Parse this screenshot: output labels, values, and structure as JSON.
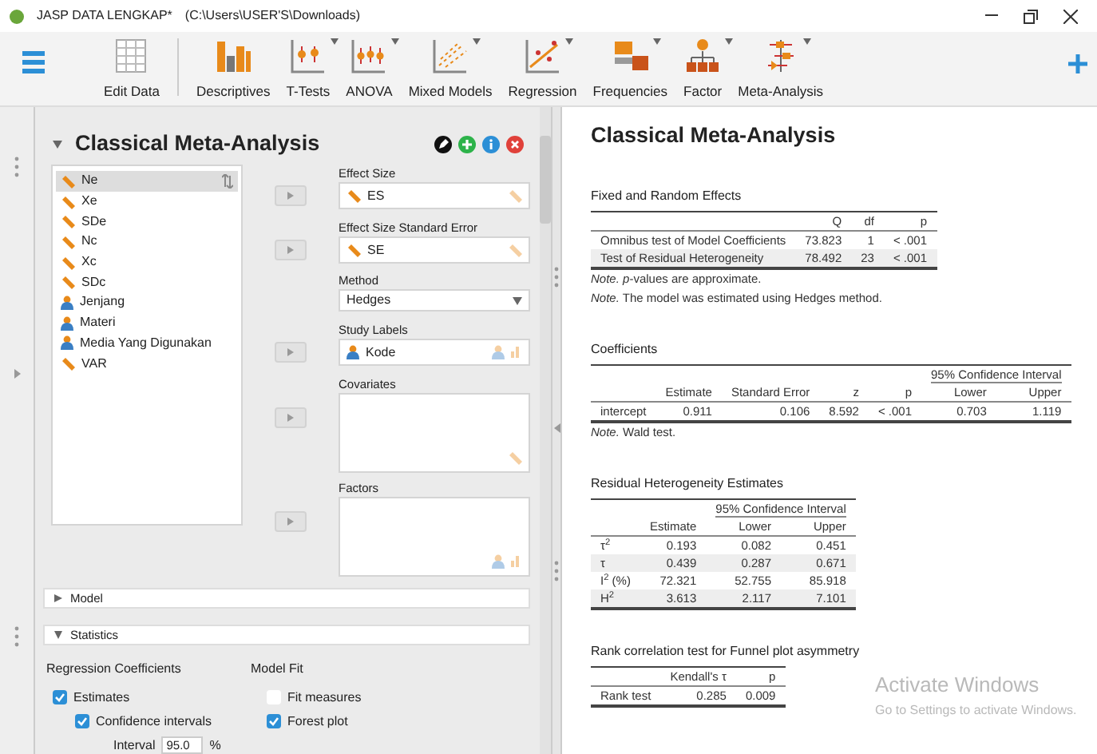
{
  "window": {
    "title": "JASP DATA LENGKAP*",
    "path": "(C:\\Users\\USER'S\\Downloads)"
  },
  "toolbar": [
    {
      "label": "Edit Data",
      "kind": "grid",
      "menu": false
    },
    {
      "label": "Descriptives",
      "kind": "bars",
      "menu": false
    },
    {
      "label": "T-Tests",
      "kind": "ttest",
      "menu": true
    },
    {
      "label": "ANOVA",
      "kind": "anova",
      "menu": true
    },
    {
      "label": "Mixed Models",
      "kind": "mixed",
      "menu": true
    },
    {
      "label": "Regression",
      "kind": "regression",
      "menu": true
    },
    {
      "label": "Frequencies",
      "kind": "freq",
      "menu": true
    },
    {
      "label": "Factor",
      "kind": "factor",
      "menu": true
    },
    {
      "label": "Meta-Analysis",
      "kind": "meta",
      "menu": true
    }
  ],
  "analysis": {
    "title": "Classical Meta-Analysis",
    "expanded": true,
    "variables": [
      {
        "name": "Ne",
        "kind": "scale",
        "selected": true
      },
      {
        "name": "Xe",
        "kind": "scale",
        "selected": false
      },
      {
        "name": "SDe",
        "kind": "scale",
        "selected": false
      },
      {
        "name": "Nc",
        "kind": "scale",
        "selected": false
      },
      {
        "name": "Xc",
        "kind": "scale",
        "selected": false
      },
      {
        "name": "SDc",
        "kind": "scale",
        "selected": false
      },
      {
        "name": "Jenjang",
        "kind": "nominal",
        "selected": false
      },
      {
        "name": "Materi",
        "kind": "nominal",
        "selected": false
      },
      {
        "name": "Media Yang Digunakan",
        "kind": "nominal",
        "selected": false
      },
      {
        "name": "VAR",
        "kind": "scale",
        "selected": false
      }
    ],
    "fields": [
      {
        "label": "Effect Size",
        "kind": "variable",
        "variable": {
          "name": "ES",
          "kind": "scale"
        },
        "allowed": {
          "kind": "scale"
        }
      },
      {
        "label": "Effect Size Standard Error",
        "kind": "variable",
        "variable": {
          "name": "SE",
          "kind": "scale"
        },
        "allowed": {
          "kind": "scale"
        }
      },
      {
        "label": "Method",
        "kind": "dropdown",
        "value": "Hedges"
      },
      {
        "label": "Study Labels",
        "kind": "variable",
        "variable": {
          "name": "Kode",
          "kind": "nominal"
        },
        "allowed": {
          "kind": "nominal"
        }
      },
      {
        "label": "Covariates",
        "kind": "box",
        "allowed": {
          "kind": "scale"
        }
      },
      {
        "label": "Factors",
        "kind": "box",
        "allowed": {
          "kind": "nominal"
        }
      }
    ],
    "sections": [
      {
        "label": "Model",
        "expanded": false
      },
      {
        "label": "Statistics",
        "expanded": true
      }
    ],
    "statistics": [
      {
        "heading": "Regression Coefficients",
        "options": [
          {
            "label": "Estimates",
            "checked": true,
            "children": [
              {
                "label": "Confidence intervals",
                "checked": true,
                "interval": {
                  "label": "Interval",
                  "value": "95.0",
                  "unit": "%"
                }
              }
            ]
          }
        ]
      },
      {
        "heading": "Model Fit",
        "options": [
          {
            "label": "Fit measures",
            "checked": false
          },
          {
            "label": "Forest plot",
            "checked": true
          }
        ]
      }
    ]
  },
  "output": {
    "title": "Classical Meta-Analysis",
    "tables": [
      {
        "title": "Fixed and Random Effects",
        "columns": [
          "",
          "Q",
          "df",
          "p"
        ],
        "rows": [
          [
            "Omnibus test of Model Coefficients",
            "73.823",
            "1",
            "< .001"
          ],
          [
            "Test of Residual Heterogeneity",
            "78.492",
            "23",
            "< .001"
          ]
        ],
        "notes": [
          "*Note.* *p*-values are approximate.",
          "*Note.* The model was estimated using Hedges method."
        ]
      },
      {
        "title": "Coefficients",
        "ci": "95% Confidence Interval",
        "columns": [
          "",
          "Estimate",
          "Standard Error",
          "z",
          "p",
          "Lower",
          "Upper"
        ],
        "rows": [
          [
            "intercept",
            "0.911",
            "0.106",
            "8.592",
            "< .001",
            "0.703",
            "1.119"
          ]
        ],
        "notes": [
          "*Note.* Wald test."
        ]
      },
      {
        "title": "Residual Heterogeneity Estimates",
        "ci": "95% Confidence Interval",
        "columns": [
          "",
          "Estimate",
          "Lower",
          "Upper"
        ],
        "rows": [
          [
            "τ$^{2}$",
            "0.193",
            "0.082",
            "0.451"
          ],
          [
            "τ",
            "0.439",
            "0.287",
            "0.671"
          ],
          [
            "I$^{2}$ (%)",
            "72.321",
            "52.755",
            "85.918"
          ],
          [
            "H$^{2}$",
            "3.613",
            "2.117",
            "7.101"
          ]
        ]
      },
      {
        "title": "Rank correlation test for Funnel plot asymmetry",
        "columns": [
          "",
          "Kendall's τ",
          "p"
        ],
        "rows": [
          [
            "Rank test",
            "0.285",
            "0.009"
          ]
        ]
      }
    ]
  },
  "os_notice": {
    "title": "Activate Windows",
    "text": "Go to Settings to activate Windows."
  }
}
